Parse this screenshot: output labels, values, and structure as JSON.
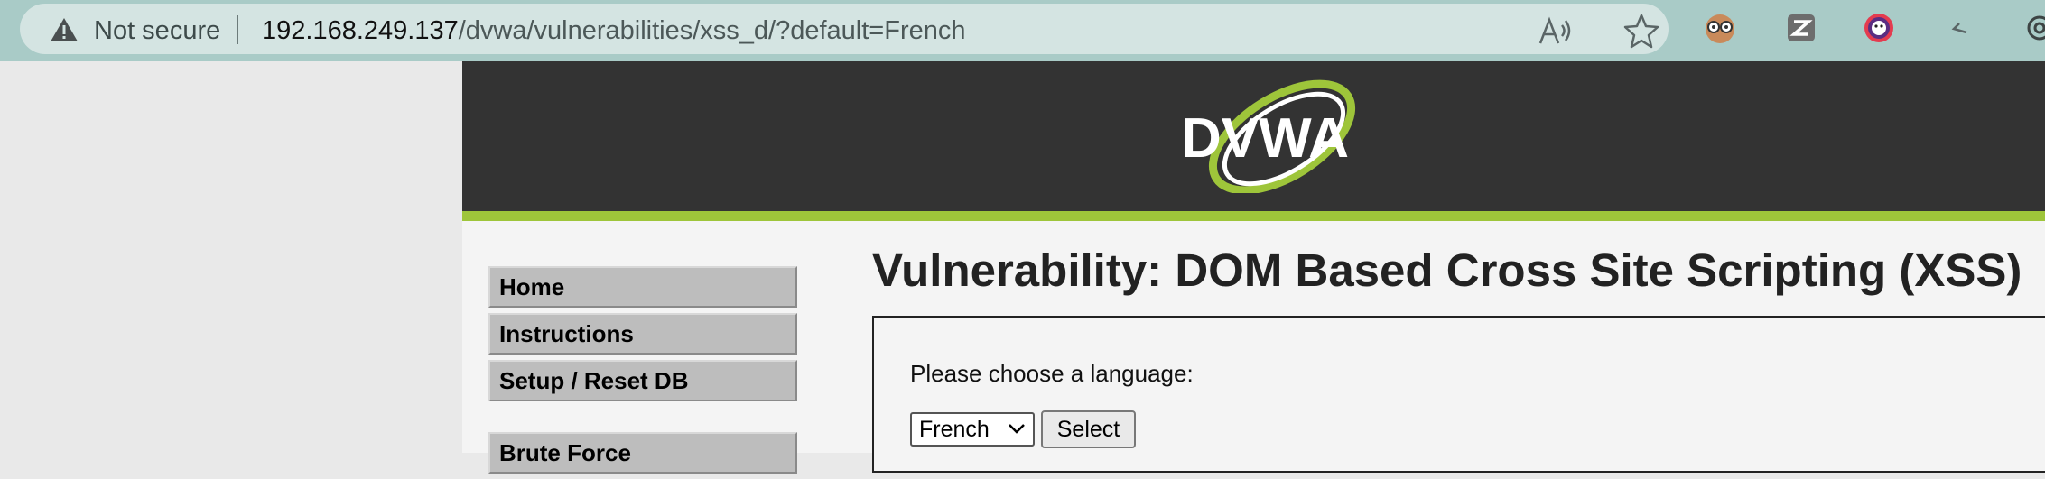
{
  "browser": {
    "security_label": "Not secure",
    "url_host": "192.168.249.137",
    "url_path": "/dvwa/vulnerabilities/xss_d/?default=French",
    "icons": [
      "warning-icon",
      "read-aloud-icon",
      "favorite-star-icon",
      "extension-icons"
    ]
  },
  "header": {
    "logo_text": "DVWA",
    "colors": {
      "header_bg": "#333333",
      "accent": "#9ec53a"
    }
  },
  "menu": {
    "items": [
      {
        "label": "Home"
      },
      {
        "label": "Instructions"
      },
      {
        "label": "Setup / Reset DB"
      },
      {
        "label": "Brute Force"
      }
    ]
  },
  "main": {
    "title": "Vulnerability: DOM Based Cross Site Scripting (XSS)",
    "prompt": "Please choose a language:",
    "language_select": {
      "selected": "French"
    },
    "select_button": "Select"
  }
}
